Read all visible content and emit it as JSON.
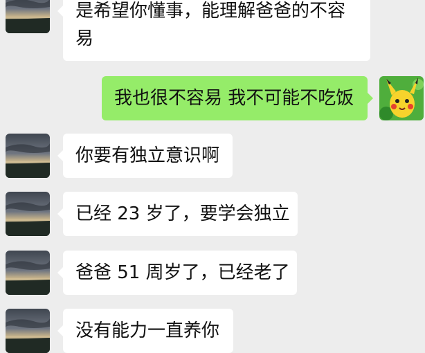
{
  "messages": [
    {
      "side": "incoming",
      "lines": [
        "是希望你懂事，能理解爸爸的不容",
        "易"
      ]
    },
    {
      "side": "outgoing",
      "lines": [
        "我也很不容易 我不可能不吃饭"
      ]
    },
    {
      "side": "incoming",
      "lines": [
        "你要有独立意识啊"
      ]
    },
    {
      "side": "incoming",
      "lines": [
        "已经 23 岁了，要学会独立"
      ]
    },
    {
      "side": "incoming",
      "lines": [
        "爸爸 51 周岁了，已经老了"
      ]
    },
    {
      "side": "incoming",
      "lines": [
        "没有能力一直养你"
      ]
    }
  ],
  "colors": {
    "background": "#ededed",
    "incoming_bubble": "#ffffff",
    "outgoing_bubble": "#95ec69"
  },
  "icons": {
    "sender_avatar": "sunset-landscape-avatar",
    "self_avatar": "pikachu-avatar"
  }
}
